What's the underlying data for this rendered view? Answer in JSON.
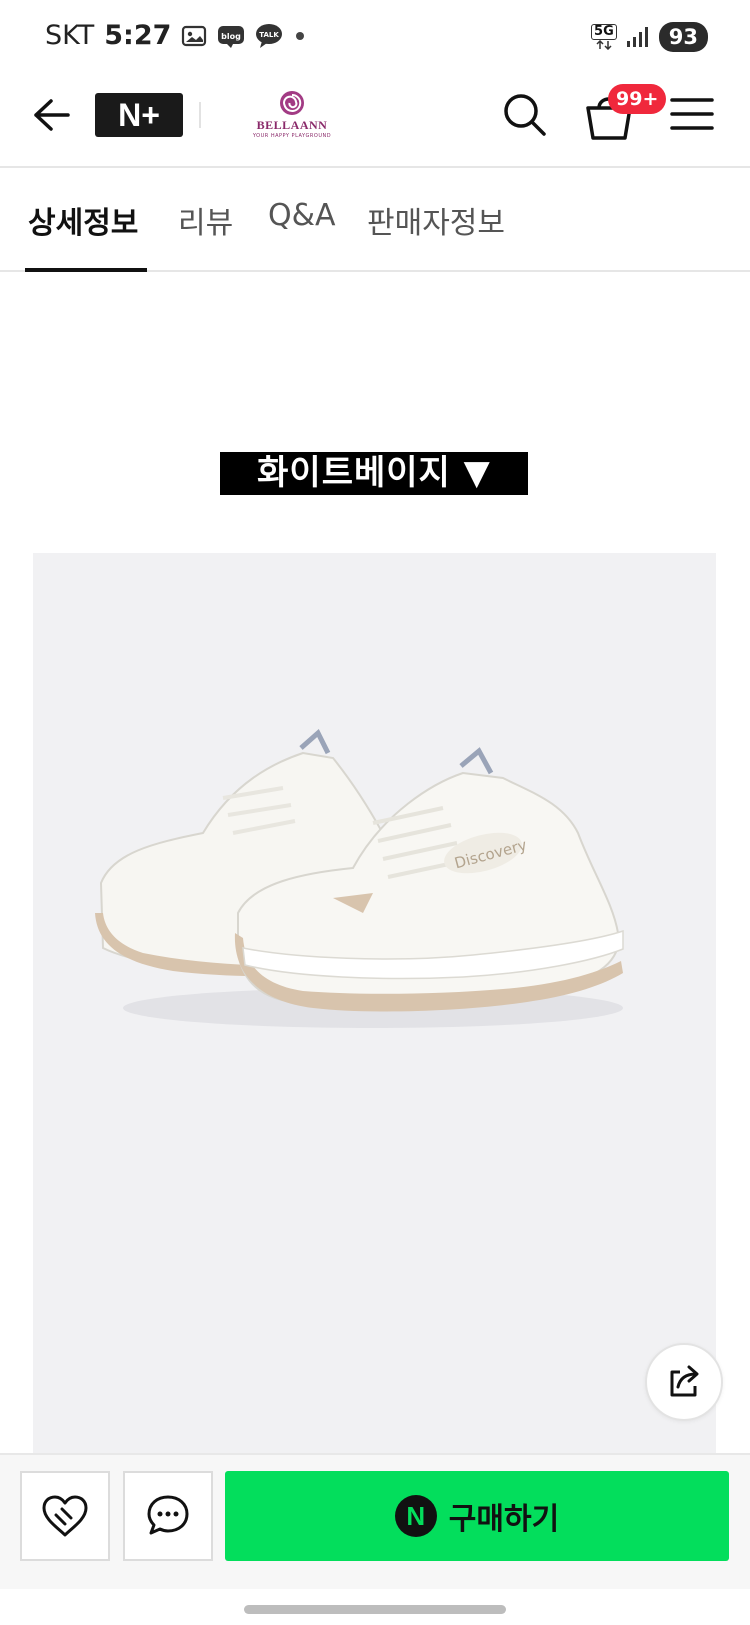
{
  "status_bar": {
    "carrier": "SKT",
    "time": "5:27",
    "network": "5G",
    "battery": "93",
    "icons": [
      "screenshot-icon",
      "blog-icon",
      "talk-icon",
      "dot-icon",
      "signal-icon"
    ],
    "blog_label": "blog",
    "talk_label": "TALK"
  },
  "header": {
    "logo": "N+",
    "brand_name": "BELLAANN",
    "brand_tagline": "YOUR HAPPY PLAYGROUND",
    "cart_badge": "99+"
  },
  "tabs": [
    {
      "label": "상세정보",
      "active": true
    },
    {
      "label": "리뷰",
      "active": false
    },
    {
      "label": "Q&A",
      "active": false
    },
    {
      "label": "판매자정보",
      "active": false
    }
  ],
  "content": {
    "color_label": "화이트베이지 ▼",
    "product_image_alt": "Discovery sneakers",
    "shoe_logo_text": "Discovery"
  },
  "bottom_bar": {
    "buy_icon": "N",
    "buy_label": "구매하기"
  },
  "colors": {
    "accent_green": "#03de5c",
    "badge_red": "#f0283c",
    "brand_purple": "#8a2a6a"
  }
}
